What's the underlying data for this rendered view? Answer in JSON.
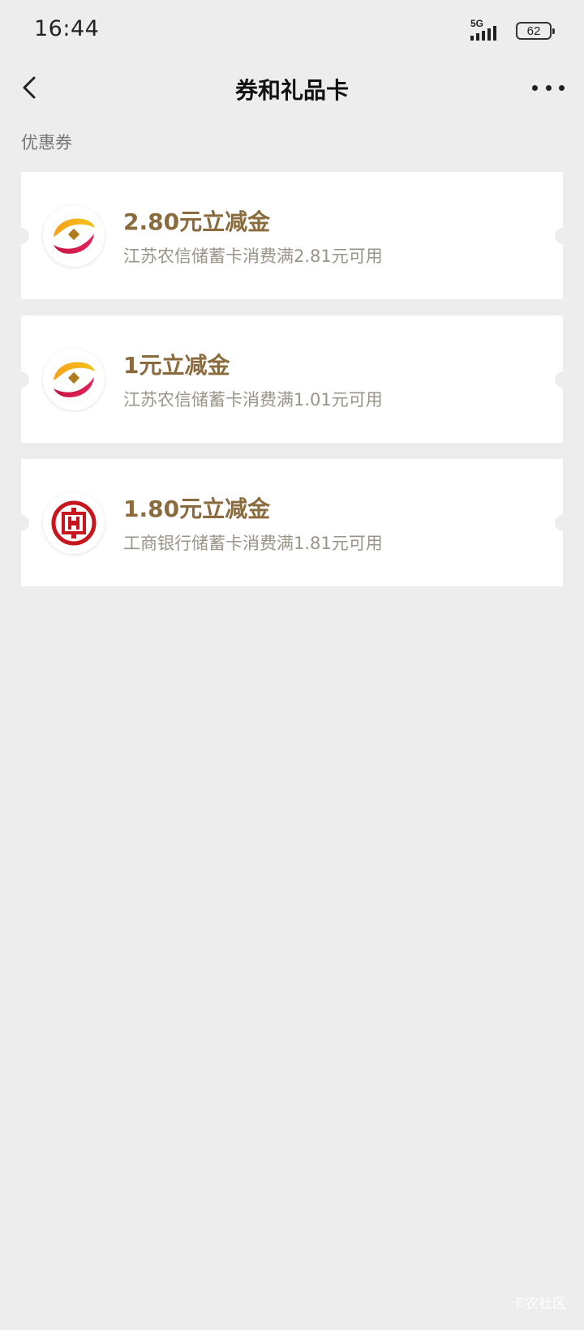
{
  "status_bar": {
    "time": "16:44",
    "network": "5G",
    "battery": "62"
  },
  "nav": {
    "title": "券和礼品卡",
    "back_icon": "chevron-left-icon",
    "more_icon": "more-dots-icon"
  },
  "section": {
    "label": "优惠券"
  },
  "coupons": [
    {
      "amount": "2.80元立减金",
      "condition": "江苏农信储蓄卡消费满2.81元可用",
      "logo": "jiangsu-rural-credit-logo"
    },
    {
      "amount": "1元立减金",
      "condition": "江苏农信储蓄卡消费满1.01元可用",
      "logo": "jiangsu-rural-credit-logo"
    },
    {
      "amount": "1.80元立减金",
      "condition": "工商银行储蓄卡消费满1.81元可用",
      "logo": "icbc-logo"
    }
  ],
  "colors": {
    "background": "#ededed",
    "card": "#ffffff",
    "amount_text": "#8a6b3d",
    "condition_text": "#9a9488",
    "icbc_red": "#c7161e"
  },
  "watermark": "卡农社区"
}
